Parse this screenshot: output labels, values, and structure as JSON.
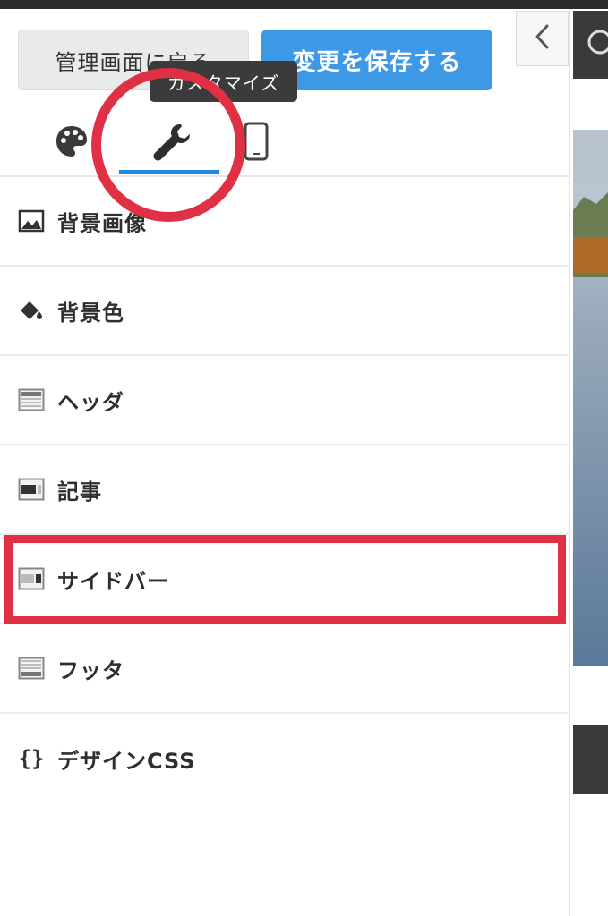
{
  "header": {
    "admin_button_label": "管理画面に戻る",
    "save_button_label": "変更を保存する",
    "collapse_icon": "chevron-left-icon"
  },
  "tabs": {
    "tooltip": "カスタマイズ",
    "items": [
      {
        "icon": "palette-icon"
      },
      {
        "icon": "wrench-icon",
        "active": true
      },
      {
        "icon": "smartphone-icon"
      }
    ],
    "active_color": "#1e88e5"
  },
  "menu": {
    "items": [
      {
        "label": "背景画像",
        "icon": "image-icon"
      },
      {
        "label": "背景色",
        "icon": "paint-bucket-icon"
      },
      {
        "label": "ヘッダ",
        "icon": "layout-header-icon"
      },
      {
        "label": "記事",
        "icon": "layout-article-icon"
      },
      {
        "label": "サイドバー",
        "icon": "layout-sidebar-icon"
      },
      {
        "label": "フッタ",
        "icon": "layout-footer-icon"
      },
      {
        "label": "デザインCSS",
        "icon": "curly-braces-icon"
      }
    ]
  },
  "colors": {
    "save_button": "#3d99e6",
    "annotation_red": "#e03044"
  }
}
